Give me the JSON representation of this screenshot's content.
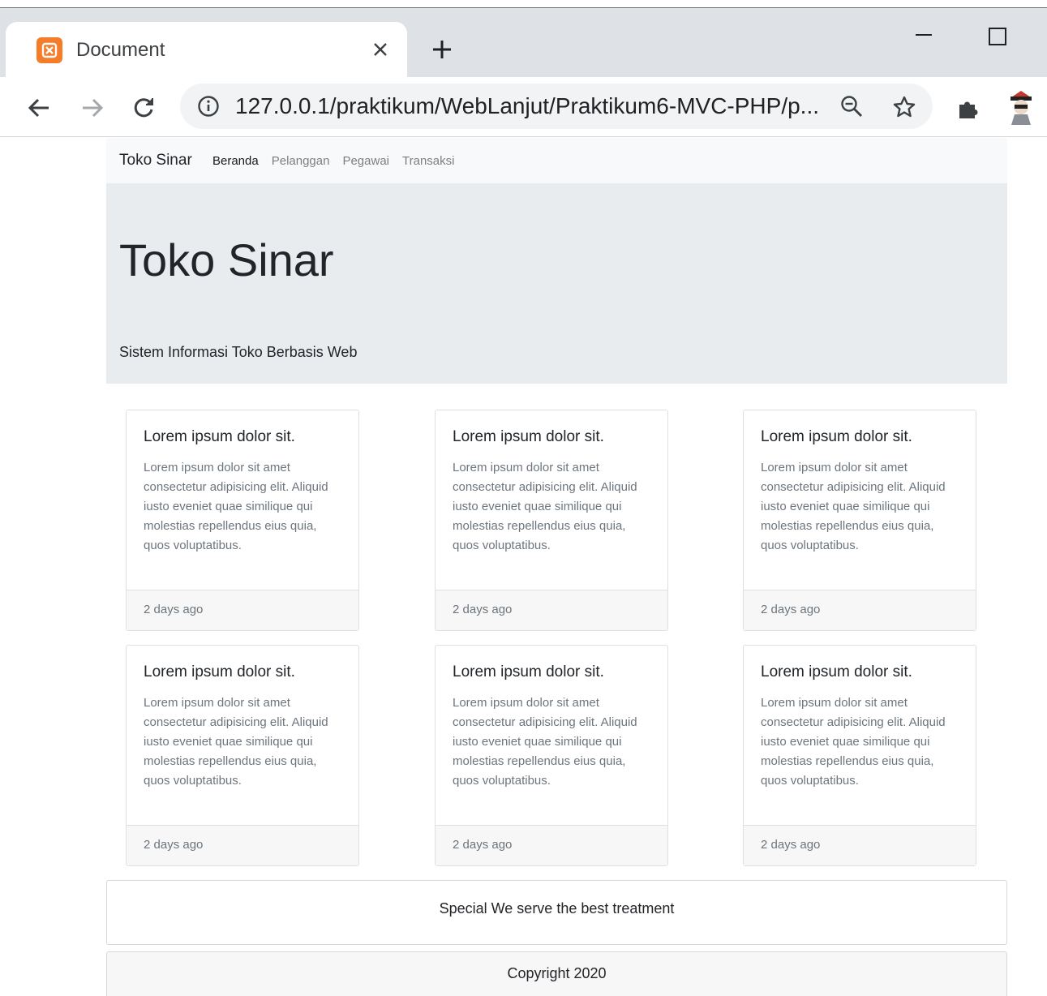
{
  "browser": {
    "tab_title": "Document",
    "url": "127.0.0.1/praktikum/WebLanjut/Praktikum6-MVC-PHP/p...",
    "icons": [
      "xampp-favicon",
      "close-icon",
      "plus-icon",
      "minimize-icon",
      "maximize-icon",
      "back-arrow-icon",
      "forward-arrow-icon",
      "reload-icon",
      "info-icon",
      "zoom-out-icon",
      "star-icon",
      "puzzle-icon",
      "avatar"
    ]
  },
  "navbar": {
    "brand": "Toko Sinar",
    "links": [
      {
        "label": "Beranda",
        "active": true
      },
      {
        "label": "Pelanggan",
        "active": false
      },
      {
        "label": "Pegawai",
        "active": false
      },
      {
        "label": "Transaksi",
        "active": false
      }
    ]
  },
  "jumbotron": {
    "title": "Toko Sinar",
    "lead": "Sistem Informasi Toko Berbasis Web"
  },
  "cards": [
    {
      "title": "Lorem ipsum dolor sit.",
      "text": "Lorem ipsum dolor sit amet consectetur adipisicing elit. Aliquid iusto eveniet quae similique qui molestias repellendus eius quia, quos voluptatibus.",
      "footer": "2 days ago"
    },
    {
      "title": "Lorem ipsum dolor sit.",
      "text": "Lorem ipsum dolor sit amet consectetur adipisicing elit. Aliquid iusto eveniet quae similique qui molestias repellendus eius quia, quos voluptatibus.",
      "footer": "2 days ago"
    },
    {
      "title": "Lorem ipsum dolor sit.",
      "text": "Lorem ipsum dolor sit amet consectetur adipisicing elit. Aliquid iusto eveniet quae similique qui molestias repellendus eius quia, quos voluptatibus.",
      "footer": "2 days ago"
    },
    {
      "title": "Lorem ipsum dolor sit.",
      "text": "Lorem ipsum dolor sit amet consectetur adipisicing elit. Aliquid iusto eveniet quae similique qui molestias repellendus eius quia, quos voluptatibus.",
      "footer": "2 days ago"
    },
    {
      "title": "Lorem ipsum dolor sit.",
      "text": "Lorem ipsum dolor sit amet consectetur adipisicing elit. Aliquid iusto eveniet quae similique qui molestias repellendus eius quia, quos voluptatibus.",
      "footer": "2 days ago"
    },
    {
      "title": "Lorem ipsum dolor sit.",
      "text": "Lorem ipsum dolor sit amet consectetur adipisicing elit. Aliquid iusto eveniet quae similique qui molestias repellendus eius quia, quos voluptatibus.",
      "footer": "2 days ago"
    }
  ],
  "special": "Special We serve the best treatment",
  "footer": "Copyright 2020"
}
